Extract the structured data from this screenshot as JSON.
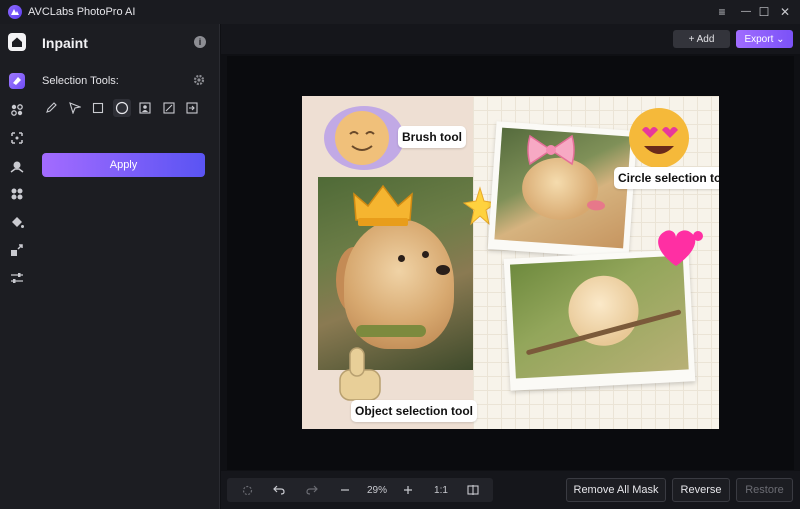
{
  "app": {
    "title": "AVCLabs PhotoPro AI"
  },
  "window_controls": {
    "menu": "≡",
    "minimize": "—",
    "maximize": "☐",
    "close": "✕"
  },
  "rail": {
    "items": [
      "home-icon",
      "inpaint-icon",
      "face-icon",
      "resize-icon",
      "remove-bg-icon",
      "colorize-icon",
      "fill-icon",
      "upscale-icon",
      "adjust-icon"
    ]
  },
  "panel": {
    "title": "Inpaint",
    "selection_label": "Selection Tools:",
    "tools": [
      "brush-icon",
      "lasso-icon",
      "rectangle-icon",
      "circle-icon",
      "person-icon",
      "object-icon",
      "import-icon"
    ],
    "active_tool": "circle-icon",
    "apply_label": "Apply"
  },
  "header": {
    "add_label": "+ Add",
    "export_label": "Export"
  },
  "canvas": {
    "callouts": {
      "brush": "Brush tool",
      "circle": "Circle selection tool",
      "object": "Object selection tool"
    }
  },
  "bottombar": {
    "zoom": "29%",
    "ratio": "1:1",
    "remove_all_mask": "Remove All Mask",
    "reverse": "Reverse",
    "restore": "Restore"
  },
  "colors": {
    "accent_start": "#a36bff",
    "accent_end": "#5a54f3",
    "background": "#0f1014"
  }
}
